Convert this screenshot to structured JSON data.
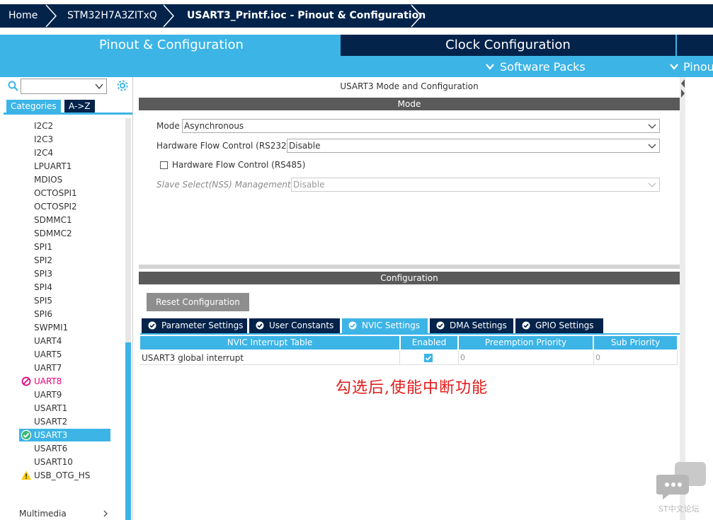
{
  "breadcrumb": {
    "items": [
      "Home",
      "STM32H7A3ZITxQ",
      "USART3_Printf.ioc - Pinout & Configuration"
    ]
  },
  "top_tabs": {
    "pinout": "Pinout & Configuration",
    "clock": "Clock Configuration",
    "software_packs": "Software Packs",
    "pinout_view": "Pinou"
  },
  "left": {
    "tabs": {
      "categories": "Categories",
      "az": "A->Z"
    },
    "items": [
      {
        "label": "I2C2",
        "state": "normal"
      },
      {
        "label": "I2C3",
        "state": "normal"
      },
      {
        "label": "I2C4",
        "state": "normal"
      },
      {
        "label": "LPUART1",
        "state": "normal"
      },
      {
        "label": "MDIOS",
        "state": "normal"
      },
      {
        "label": "OCTOSPI1",
        "state": "normal"
      },
      {
        "label": "OCTOSPI2",
        "state": "normal"
      },
      {
        "label": "SDMMC1",
        "state": "normal"
      },
      {
        "label": "SDMMC2",
        "state": "normal"
      },
      {
        "label": "SPI1",
        "state": "normal"
      },
      {
        "label": "SPI2",
        "state": "normal"
      },
      {
        "label": "SPI3",
        "state": "normal"
      },
      {
        "label": "SPI4",
        "state": "normal"
      },
      {
        "label": "SPI5",
        "state": "normal"
      },
      {
        "label": "SPI6",
        "state": "normal"
      },
      {
        "label": "SWPMI1",
        "state": "normal"
      },
      {
        "label": "UART4",
        "state": "normal"
      },
      {
        "label": "UART5",
        "state": "normal"
      },
      {
        "label": "UART7",
        "state": "normal"
      },
      {
        "label": "UART8",
        "state": "disabled"
      },
      {
        "label": "UART9",
        "state": "normal"
      },
      {
        "label": "USART1",
        "state": "normal"
      },
      {
        "label": "USART2",
        "state": "normal"
      },
      {
        "label": "USART3",
        "state": "selected"
      },
      {
        "label": "USART6",
        "state": "normal"
      },
      {
        "label": "USART10",
        "state": "normal"
      },
      {
        "label": "USB_OTG_HS",
        "state": "warning"
      }
    ],
    "group_multimedia": "Multimedia"
  },
  "right": {
    "title": "USART3 Mode and Configuration",
    "mode_header": "Mode",
    "mode": {
      "mode_label": "Mode",
      "mode_value": "Asynchronous",
      "hfc232_label": "Hardware Flow Control (RS232)",
      "hfc232_value": "Disable",
      "hfc485_label": "Hardware Flow Control (RS485)",
      "nss_label": "Slave Select(NSS) Management",
      "nss_value": "Disable"
    },
    "config_header": "Configuration",
    "reset_label": "Reset Configuration",
    "config_tabs": [
      "Parameter Settings",
      "User Constants",
      "NVIC Settings",
      "DMA Settings",
      "GPIO Settings"
    ],
    "active_tab": "NVIC Settings",
    "nvic": {
      "headers": [
        "NVIC Interrupt Table",
        "Enabled",
        "Preemption Priority",
        "Sub Priority"
      ],
      "rows": [
        {
          "name": "USART3 global interrupt",
          "enabled": true,
          "preemption": "0",
          "sub": "0"
        }
      ]
    }
  },
  "annotation": "勾选后,使能中断功能",
  "watermark": "ST中文论坛",
  "colors": {
    "navy": "#03234b",
    "accent": "#3cb4e6",
    "header_gray": "#5a5a5a",
    "annotation_red": "#e31b1b"
  }
}
